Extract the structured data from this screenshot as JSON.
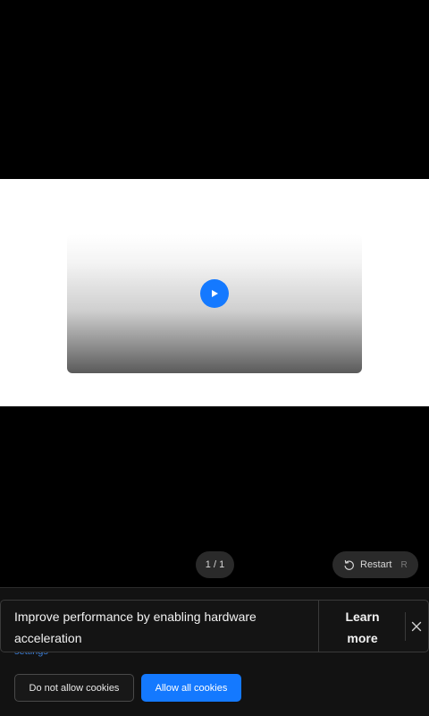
{
  "player": {
    "play_label": "Play",
    "counter": "1 / 1",
    "restart_label": "Restart",
    "restart_shortcut": "R"
  },
  "cookies": {
    "settings_link": "settings",
    "deny_label": "Do not allow cookies",
    "allow_label": "Allow all cookies"
  },
  "toast": {
    "message": "Improve performance by enabling hardware acceleration",
    "learn_more": "Learn more"
  },
  "colors": {
    "accent": "#1479ff",
    "background": "#000000",
    "panel": "#121212"
  },
  "icons": {
    "play": "play-icon",
    "restart": "restart-icon",
    "close": "close-icon"
  }
}
